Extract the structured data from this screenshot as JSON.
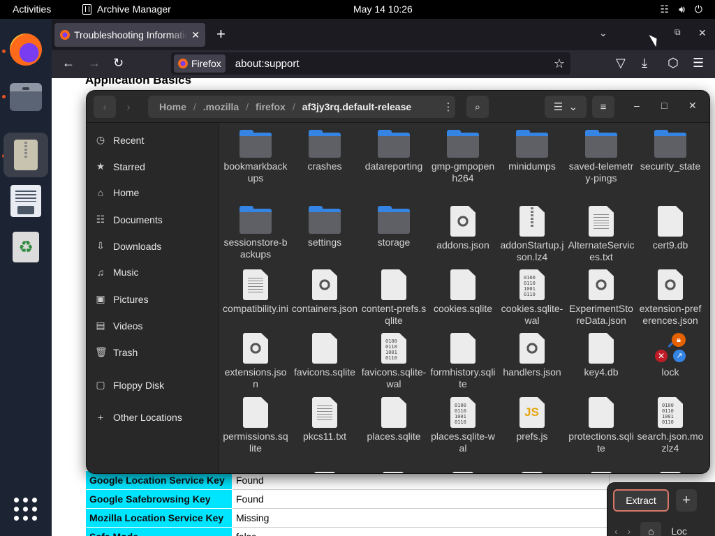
{
  "topbar": {
    "activities": "Activities",
    "app_name": "Archive Manager",
    "clock": "May 14  10:26",
    "tray": [
      "network-icon",
      "volume-icon",
      "power-icon"
    ]
  },
  "dock": {
    "items": [
      "Firefox",
      "Files",
      "Archive Manager",
      "Text Editor",
      "Trash",
      "Show Applications"
    ]
  },
  "firefox": {
    "tab_title": "Troubleshooting Information",
    "identity_label": "Firefox",
    "url": "about:support",
    "page_heading": "Application Basics",
    "table_rows": [
      {
        "key": "Google Location Service Key",
        "value": "Found"
      },
      {
        "key": "Google Safebrowsing Key",
        "value": "Found"
      },
      {
        "key": "Mozilla Location Service Key",
        "value": "Missing"
      },
      {
        "key": "Safe Mode",
        "value": "false"
      }
    ]
  },
  "archive": {
    "path": [
      "Home",
      ".mozilla",
      "firefox",
      "af3jy3rq.default-release"
    ],
    "sidebar": [
      {
        "label": "Recent",
        "icon": "clock-icon"
      },
      {
        "label": "Starred",
        "icon": "star-icon"
      },
      {
        "label": "Home",
        "icon": "home-icon"
      },
      {
        "label": "Documents",
        "icon": "document-icon"
      },
      {
        "label": "Downloads",
        "icon": "download-icon"
      },
      {
        "label": "Music",
        "icon": "music-icon"
      },
      {
        "label": "Pictures",
        "icon": "picture-icon"
      },
      {
        "label": "Videos",
        "icon": "video-icon"
      },
      {
        "label": "Trash",
        "icon": "trash-icon"
      },
      {
        "label": "Floppy Disk",
        "icon": "floppy-icon"
      },
      {
        "label": "Other Locations",
        "icon": "plus-icon"
      }
    ],
    "files": [
      {
        "name": "bookmarkbackups",
        "type": "folder"
      },
      {
        "name": "crashes",
        "type": "folder"
      },
      {
        "name": "datareporting",
        "type": "folder"
      },
      {
        "name": "gmp-gmpopenh264",
        "type": "folder"
      },
      {
        "name": "minidumps",
        "type": "folder"
      },
      {
        "name": "saved-telemetry-pings",
        "type": "folder"
      },
      {
        "name": "security_state",
        "type": "folder"
      },
      {
        "name": "sessionstore-backups",
        "type": "folder"
      },
      {
        "name": "settings",
        "type": "folder"
      },
      {
        "name": "storage",
        "type": "folder"
      },
      {
        "name": "addons.json",
        "type": "json"
      },
      {
        "name": "addonStartup.json.lz4",
        "type": "zip"
      },
      {
        "name": "AlternateServices.txt",
        "type": "text"
      },
      {
        "name": "cert9.db",
        "type": "blank"
      },
      {
        "name": "compatibility.ini",
        "type": "text"
      },
      {
        "name": "containers.json",
        "type": "json"
      },
      {
        "name": "content-prefs.sqlite",
        "type": "blank"
      },
      {
        "name": "cookies.sqlite",
        "type": "blank"
      },
      {
        "name": "cookies.sqlite-wal",
        "type": "bin"
      },
      {
        "name": "ExperimentStoreData.json",
        "type": "json"
      },
      {
        "name": "extension-preferences.json",
        "type": "json"
      },
      {
        "name": "extensions.json",
        "type": "json"
      },
      {
        "name": "favicons.sqlite",
        "type": "blank"
      },
      {
        "name": "favicons.sqlite-wal",
        "type": "bin"
      },
      {
        "name": "formhistory.sqlite",
        "type": "blank"
      },
      {
        "name": "handlers.json",
        "type": "json"
      },
      {
        "name": "key4.db",
        "type": "blank"
      },
      {
        "name": "lock",
        "type": "lock"
      },
      {
        "name": "permissions.sqlite",
        "type": "blank"
      },
      {
        "name": "pkcs11.txt",
        "type": "text"
      },
      {
        "name": "places.sqlite",
        "type": "blank"
      },
      {
        "name": "places.sqlite-wal",
        "type": "bin"
      },
      {
        "name": "prefs.js",
        "type": "js"
      },
      {
        "name": "protections.sqlite",
        "type": "blank"
      },
      {
        "name": "search.json.mozlz4",
        "type": "bin"
      }
    ]
  },
  "archive2": {
    "extract_label": "Extract",
    "add_label": "+",
    "location_partial": "Loc"
  }
}
